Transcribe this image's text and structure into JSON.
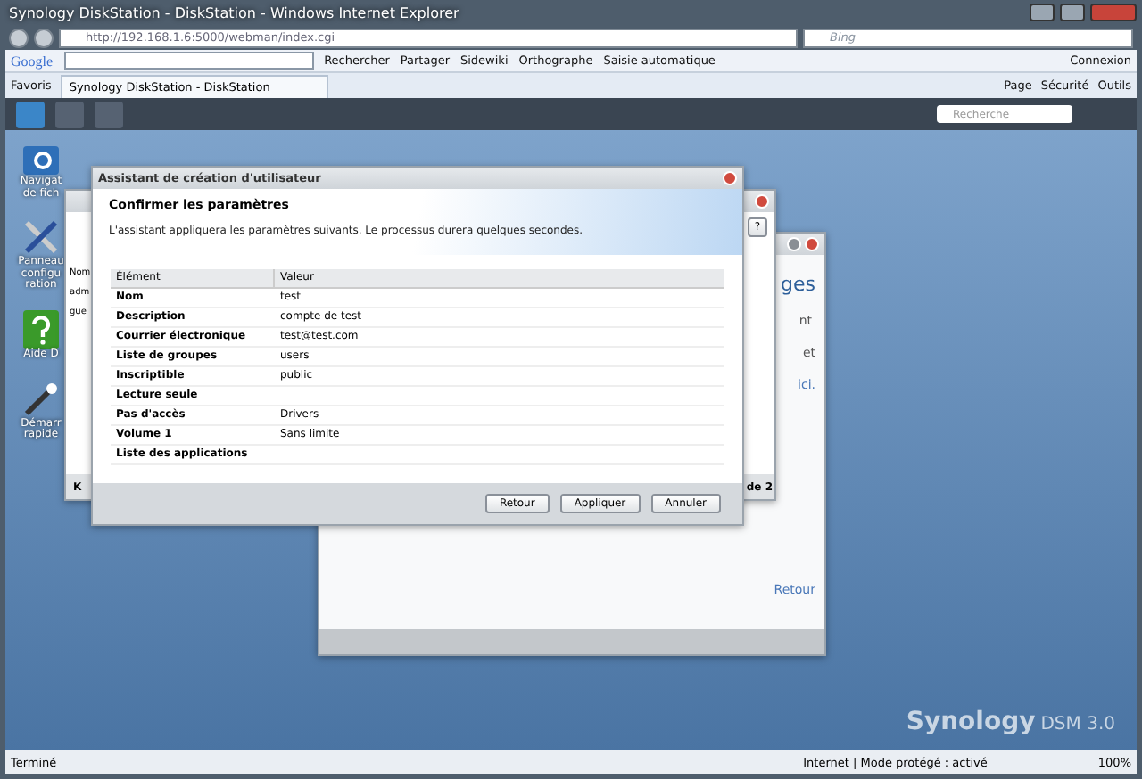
{
  "browser": {
    "title": "Synology DiskStation - DiskStation - Windows Internet Explorer",
    "address": "http://192.168.1.6:5000/webman/index.cgi",
    "search_placeholder": "Bing"
  },
  "google_toolbar": {
    "logo": "Google",
    "items": [
      "Rechercher",
      "Partager",
      "Sidewiki",
      "Orthographe",
      "Saisie automatique"
    ],
    "connexion": "Connexion"
  },
  "favorites_bar": {
    "favorites": "Favoris",
    "tab": "Synology DiskStation - DiskStation",
    "commands": [
      "Page",
      "Sécurité",
      "Outils"
    ]
  },
  "taskbar": {
    "search_placeholder": "Recherche"
  },
  "desktop_icons": [
    {
      "kind": "folder",
      "lines": [
        "Navigat",
        "de fich"
      ]
    },
    {
      "kind": "tools",
      "lines": [
        "Panneau",
        "configu",
        "ration"
      ]
    },
    {
      "kind": "help",
      "lines": [
        "Aide D"
      ]
    },
    {
      "kind": "wand",
      "lines": [
        "Démarr",
        "rapide"
      ]
    }
  ],
  "welcome_window": {
    "heading": "ges",
    "lines": [
      "nt",
      "et"
    ],
    "link_text": "ici.",
    "back_link": "Retour"
  },
  "users_window": {
    "column": "Nom",
    "rows": [
      "adm",
      "gue"
    ],
    "pager": "K",
    "page_info": "de 2",
    "help": "?"
  },
  "dialog": {
    "title": "Assistant de création d'utilisateur",
    "heading": "Confirmer les paramètres",
    "description": "L'assistant appliquera les paramètres suivants. Le processus durera quelques secondes.",
    "columns": [
      "Élément",
      "Valeur"
    ],
    "rows": [
      {
        "item": "Nom",
        "value": "test"
      },
      {
        "item": "Description",
        "value": "compte de test"
      },
      {
        "item": "Courrier électronique",
        "value": "test@test.com"
      },
      {
        "item": "Liste de groupes",
        "value": "users"
      },
      {
        "item": "Inscriptible",
        "value": "public"
      },
      {
        "item": "Lecture seule",
        "value": ""
      },
      {
        "item": "Pas d'accès",
        "value": "Drivers"
      },
      {
        "item": "Volume 1",
        "value": "Sans limite"
      },
      {
        "item": "Liste des applications",
        "value": ""
      }
    ],
    "buttons": [
      "Retour",
      "Appliquer",
      "Annuler"
    ]
  },
  "branding": {
    "logo": "Synology",
    "version": "DSM 3.0"
  },
  "status_bar": {
    "status": "Terminé",
    "zone": "Internet | Mode protégé : activé",
    "zoom": "100%"
  }
}
